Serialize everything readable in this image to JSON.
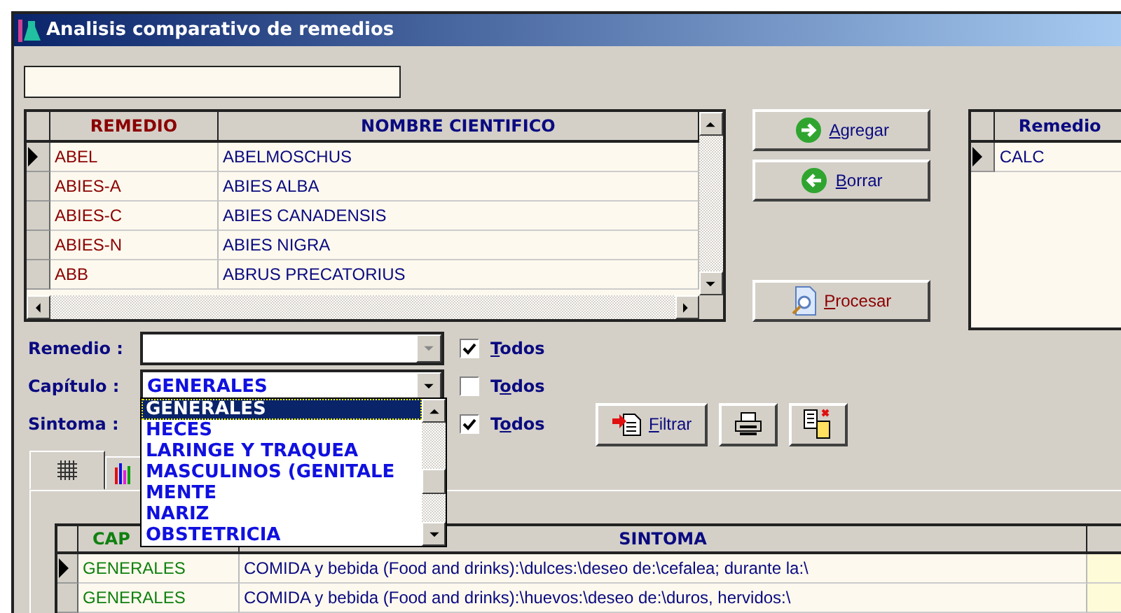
{
  "window": {
    "title": "Analisis comparativo de remedios"
  },
  "search": {
    "kind": "text"
  },
  "remedies_table": {
    "columns": [
      "REMEDIO",
      "NOMBRE CIENTIFICO"
    ],
    "rows": [
      {
        "remedio": "ABEL",
        "nombre": "ABELMOSCHUS",
        "current": true
      },
      {
        "remedio": "ABIES-A",
        "nombre": "ABIES ALBA",
        "current": false
      },
      {
        "remedio": "ABIES-C",
        "nombre": "ABIES CANADENSIS",
        "current": false
      },
      {
        "remedio": "ABIES-N",
        "nombre": "ABIES NIGRA",
        "current": false
      },
      {
        "remedio": "ABB",
        "nombre": "ABRUS PRECATORIUS",
        "current": false
      }
    ]
  },
  "actions": [
    {
      "label": "Agregar",
      "kind": "add"
    },
    {
      "label": "Borrar",
      "kind": "remove"
    },
    {
      "label": "Procesar",
      "kind": "process"
    }
  ],
  "selected_table": {
    "columns": [
      "Remedio"
    ],
    "rows": [
      {
        "remedio": "CALC",
        "current": true
      }
    ]
  },
  "filters": [
    {
      "label": "Remedio :",
      "kind": "combo",
      "disabled": true,
      "all_label": "Todos",
      "key_on_second_letter": false,
      "all_checked": true
    },
    {
      "label": "Capítulo :",
      "kind": "combo",
      "value": "GENERALES",
      "disabled": false,
      "open": true,
      "all_label": "Todos",
      "key_on_second_letter": true,
      "all_checked": false
    },
    {
      "label": "Sintoma :",
      "kind": "covered",
      "all_label": "Todos",
      "key_on_second_letter": true,
      "all_checked": true
    }
  ],
  "dropdown": {
    "items": [
      {
        "label": "GENERALES",
        "selected": true
      },
      {
        "label": "HECES",
        "selected": false
      },
      {
        "label": "LARINGE Y TRAQUEA",
        "selected": false
      },
      {
        "label": "MASCULINOS (GENITALE",
        "selected": false
      },
      {
        "label": "MENTE",
        "selected": false
      },
      {
        "label": "NARIZ",
        "selected": false
      },
      {
        "label": "OBSTETRICIA",
        "selected": false
      }
    ]
  },
  "tools": [
    {
      "kind": "filter",
      "label": "Filtrar"
    },
    {
      "kind": "print"
    },
    {
      "kind": "export"
    }
  ],
  "tabs": [
    {
      "kind": "grid",
      "selected": true
    },
    {
      "kind": "chart",
      "selected": false
    }
  ],
  "symptoms_table": {
    "columns": [
      "CAP",
      "SINTOMA"
    ],
    "rows": [
      {
        "capitulo": "GENERALES",
        "sintoma": "COMIDA y bebida (Food and drinks):\\dulces:\\deseo de:\\cefalea; durante la:\\",
        "current": true
      },
      {
        "capitulo": "GENERALES",
        "sintoma": "COMIDA y bebida (Food and drinks):\\huevos:\\deseo de:\\duros, hervidos:\\",
        "current": false
      }
    ]
  }
}
